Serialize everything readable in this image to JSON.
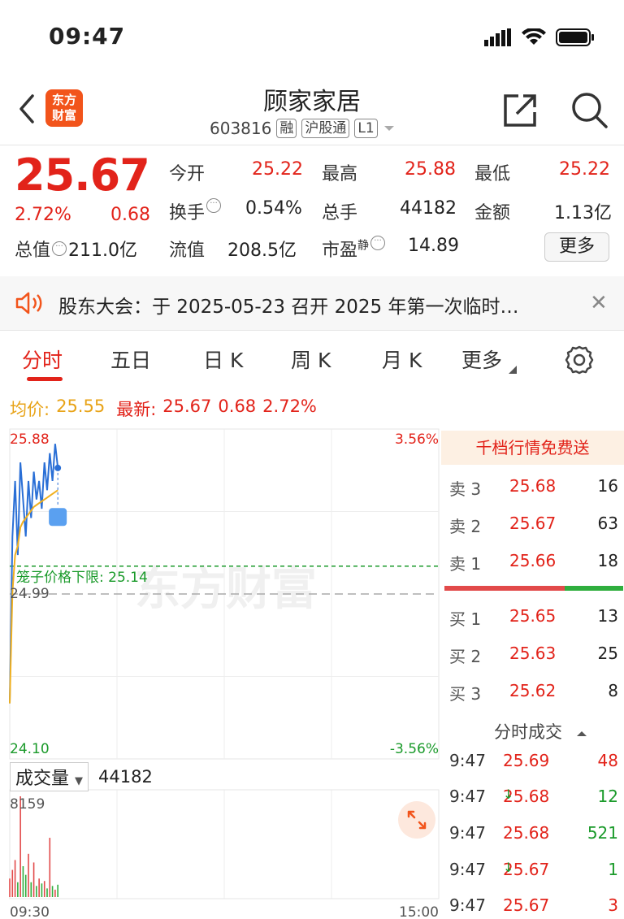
{
  "status_bar": {
    "time": "09:47"
  },
  "header": {
    "logo_line1": "东方",
    "logo_line2": "财富",
    "name": "顾家家居",
    "code": "603816",
    "tags": [
      "融",
      "沪股通",
      "L1"
    ]
  },
  "quote": {
    "price": "25.67",
    "change_pct": "2.72%",
    "change": "0.68",
    "fields": [
      {
        "label": "今开",
        "value": "25.22",
        "color": "red"
      },
      {
        "label": "最高",
        "value": "25.88",
        "color": "red"
      },
      {
        "label": "最低",
        "value": "25.22",
        "color": "red"
      },
      {
        "label": "换手",
        "value": "0.54%",
        "color": "black"
      },
      {
        "label": "总手",
        "value": "44182",
        "color": "black"
      },
      {
        "label": "金额",
        "value": "1.13亿",
        "color": "black"
      },
      {
        "label": "流值",
        "value": "208.5亿",
        "color": "black"
      },
      {
        "label": "市盈",
        "value": "14.89",
        "color": "black"
      }
    ],
    "mktcap_label": "总值",
    "mktcap_value": "211.0亿",
    "pe_sup": "静",
    "more_label": "更多"
  },
  "notice": {
    "text": "股东大会：于 2025-05-23 召开 2025 年第一次临时…"
  },
  "tabs": [
    {
      "label": "分时",
      "active": true
    },
    {
      "label": "五日"
    },
    {
      "label": "日 K"
    },
    {
      "label": "周 K"
    },
    {
      "label": "月 K"
    },
    {
      "label": "更多"
    }
  ],
  "chart_head": {
    "avg_label": "均价:",
    "avg_value": "25.55",
    "latest_label": "最新:",
    "latest_value": "25.67",
    "latest_change": "0.68",
    "latest_pct": "2.72%"
  },
  "chart_data": {
    "type": "line",
    "ylim": [
      24.1,
      25.88
    ],
    "y_top_label": "25.88",
    "y_mid_label": "24.99",
    "y_bottom_label": "24.10",
    "pct_top_label": "3.56%",
    "pct_bottom_label": "-3.56%",
    "limit_line_label": "笼子价格下限: 25.14",
    "limit_line_value": 25.14,
    "prev_close": 24.99,
    "series": [
      {
        "values": [
          24.4,
          25.3,
          25.6,
          25.2,
          25.7,
          25.5,
          25.3,
          25.6,
          25.4,
          25.65,
          25.5,
          25.6,
          25.45,
          25.7,
          25.55,
          25.75,
          25.6,
          25.8,
          25.67
        ]
      },
      {
        "values": [
          24.4,
          25.0,
          25.2,
          25.25,
          25.35,
          25.38,
          25.4,
          25.42,
          25.44,
          25.46,
          25.47,
          25.48,
          25.49,
          25.5,
          25.51,
          25.52,
          25.53,
          25.54,
          25.55
        ]
      }
    ],
    "x_start_label": "09:30",
    "x_end_label": "15:00",
    "volume_max_label": "8159",
    "volume": [
      1500,
      2200,
      3000,
      1200,
      8159,
      2500,
      1800,
      3500,
      1200,
      2800,
      900,
      1500,
      1100,
      1300,
      700,
      4800,
      900,
      600,
      1000
    ]
  },
  "volume_head": {
    "select_label": "成交量",
    "value": "44182"
  },
  "watermark": "东方财富",
  "promo": "千档行情免费送",
  "order_book": {
    "asks": [
      {
        "label": "卖 3",
        "price": "25.68",
        "vol": "16"
      },
      {
        "label": "卖 2",
        "price": "25.67",
        "vol": "63"
      },
      {
        "label": "卖 1",
        "price": "25.66",
        "vol": "18"
      }
    ],
    "bids": [
      {
        "label": "买 1",
        "price": "25.65",
        "vol": "13"
      },
      {
        "label": "买 2",
        "price": "25.63",
        "vol": "25"
      },
      {
        "label": "买 3",
        "price": "25.62",
        "vol": "8"
      }
    ]
  },
  "trades_title": "分时成交",
  "trades": [
    {
      "time": "9:47",
      "price": "25.69",
      "arrow": "",
      "vol": "48",
      "vol_color": "red"
    },
    {
      "time": "9:47",
      "price": "25.68",
      "arrow": "↓",
      "vol": "12",
      "vol_color": "green"
    },
    {
      "time": "9:47",
      "price": "25.68",
      "arrow": "",
      "vol": "521",
      "vol_color": "green"
    },
    {
      "time": "9:47",
      "price": "25.67",
      "arrow": "↓",
      "vol": "1",
      "vol_color": "green"
    },
    {
      "time": "9:47",
      "price": "25.67",
      "arrow": "",
      "vol": "3",
      "vol_color": "red"
    }
  ]
}
